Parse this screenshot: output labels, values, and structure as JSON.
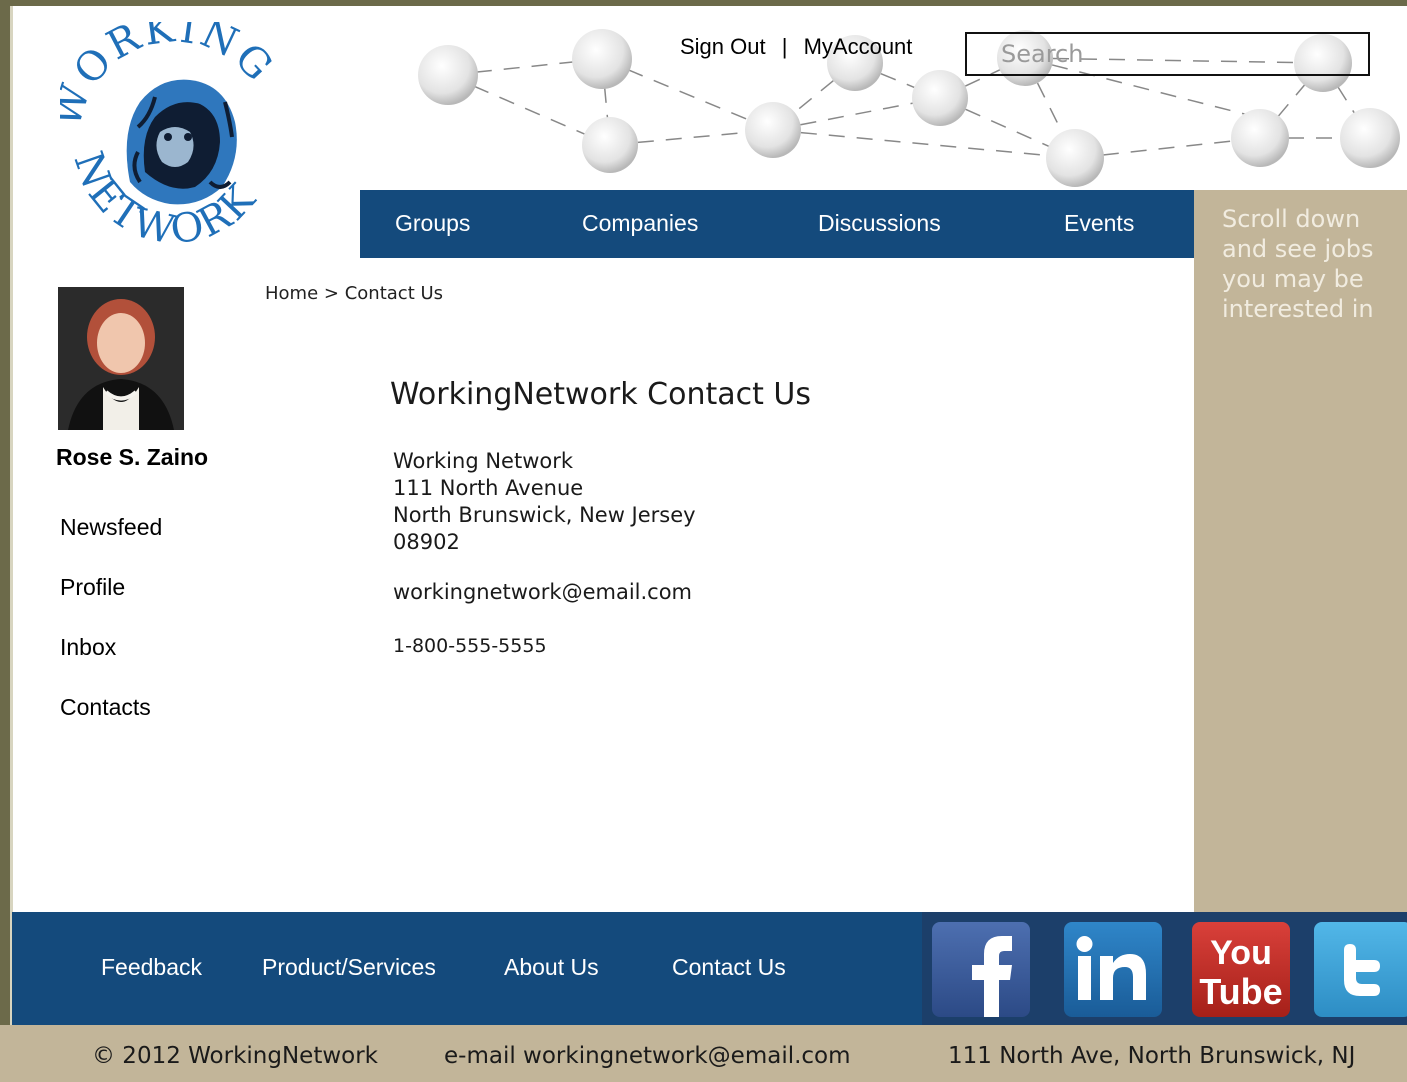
{
  "header": {
    "logo_text_top": "WORKING",
    "logo_text_bottom": "NETWORK",
    "sign_out": "Sign Out",
    "separator": "|",
    "my_account": "MyAccount",
    "search_placeholder": "Search"
  },
  "main_nav": {
    "items": [
      {
        "label": "Groups"
      },
      {
        "label": "Companies"
      },
      {
        "label": "Discussions"
      },
      {
        "label": "Events"
      }
    ]
  },
  "side_panel": {
    "promo_text": "Scroll down and see jobs you may be interested in"
  },
  "user": {
    "name": "Rose S. Zaino"
  },
  "left_nav": {
    "items": [
      {
        "label": "Newsfeed"
      },
      {
        "label": "Profile"
      },
      {
        "label": "Inbox"
      },
      {
        "label": "Contacts"
      }
    ]
  },
  "breadcrumb": {
    "home": "Home",
    "sep": ">",
    "current": "Contact Us"
  },
  "content": {
    "title": "WorkingNetwork Contact Us",
    "address_lines": [
      "Working Network",
      "111 North Avenue",
      "North Brunswick, New Jersey",
      "08902"
    ],
    "email": "workingnetwork@email.com",
    "phone": "1-800-555-5555"
  },
  "footer_nav": {
    "items": [
      {
        "label": "Feedback"
      },
      {
        "label": "Product/Services"
      },
      {
        "label": "About Us"
      },
      {
        "label": "Contact Us"
      }
    ],
    "social": [
      {
        "name": "facebook-icon",
        "text": "f",
        "color": "#3b5998"
      },
      {
        "name": "linkedin-icon",
        "text": "in",
        "color": "#1f6fb0"
      },
      {
        "name": "youtube-icon",
        "text_top": "You",
        "text_bottom": "Tube",
        "color": "#c4302b"
      },
      {
        "name": "twitter-icon",
        "text": "B",
        "color": "#3fa9e0"
      }
    ]
  },
  "copyright": {
    "copy": "© 2012 WorkingNetwork",
    "email": "e-mail workingnetwork@email.com",
    "address": "111 North Ave, North Brunswick, NJ"
  },
  "colors": {
    "nav_blue": "#144a7c",
    "tan": "#c2b599",
    "frame": "#6c6a4a"
  }
}
